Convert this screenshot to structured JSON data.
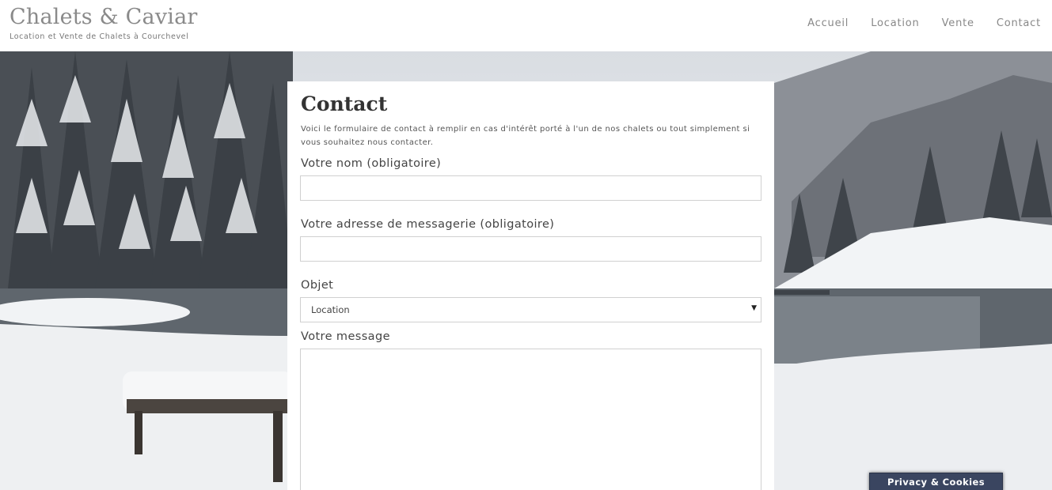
{
  "site": {
    "title": "Chalets & Caviar",
    "tagline": "Location et Vente de Chalets à Courchevel"
  },
  "nav": {
    "items": [
      "Accueil",
      "Location",
      "Vente",
      "Contact"
    ]
  },
  "page": {
    "heading": "Contact",
    "intro": "Voici le formulaire de contact à remplir en cas d'intérêt porté à l'un de nos chalets ou tout simplement si vous souhaitez nous contacter."
  },
  "form": {
    "name_label": "Votre nom (obligatoire)",
    "name_value": "",
    "email_label": "Votre adresse de messagerie (obligatoire)",
    "email_value": "",
    "subject_label": "Objet",
    "subject_selected": "Location",
    "message_label": "Votre message",
    "message_value": ""
  },
  "cookie": {
    "label": "Privacy & Cookies Policy"
  },
  "colors": {
    "cookie_bg": "#3a4560",
    "header_text": "#8a8a8a"
  }
}
